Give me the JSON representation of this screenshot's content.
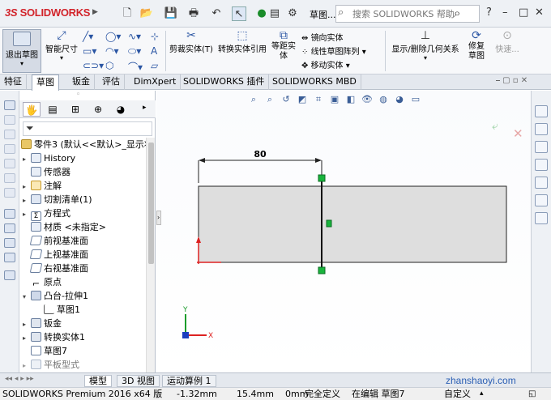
{
  "app": {
    "logo_prefix": "3S",
    "logo_text": "SOLIDWORKS",
    "title": "草图..."
  },
  "quick_access": [
    "new-icon",
    "open-icon",
    "save-icon",
    "print-icon",
    "undo-icon",
    "select-icon",
    "rebuild-icon",
    "file-properties-icon",
    "options-icon"
  ],
  "help_search": {
    "placeholder": "搜索 SOLIDWORKS 帮助"
  },
  "window_controls": {
    "help": "?",
    "minimize": "–",
    "restore": "□",
    "close": "✕"
  },
  "command_manager": {
    "exit_sketch": "退出草图",
    "smart_dimension": "智能尺寸",
    "trim_entities": "剪裁实体(T)",
    "convert_entities": "转换实体引用",
    "offset_entities": "等距实体",
    "mirror_entities": "镜向实体",
    "linear_pattern": "线性草图阵列",
    "move_entities": "移动实体",
    "display_relations": "显示/删除几何关系",
    "repair_sketch": "修复草图",
    "quick_snaps": "快速..."
  },
  "tabs": [
    "特征",
    "草图",
    "钣金",
    "评估",
    "DimXpert",
    "SOLIDWORKS 插件",
    "SOLIDWORKS MBD"
  ],
  "active_tab": "草图",
  "feature_tree": {
    "root": "零件3 (默认<<默认>_显示状",
    "items": [
      {
        "label": "History",
        "exp": "▸"
      },
      {
        "label": "传感器",
        "exp": ""
      },
      {
        "label": "注解",
        "exp": "▸"
      },
      {
        "label": "切割清单(1)",
        "exp": "▸"
      },
      {
        "label": "方程式",
        "exp": "▸"
      },
      {
        "label": "材质 <未指定>",
        "exp": ""
      },
      {
        "label": "前视基准面",
        "exp": ""
      },
      {
        "label": "上视基准面",
        "exp": ""
      },
      {
        "label": "右视基准面",
        "exp": ""
      },
      {
        "label": "原点",
        "exp": ""
      },
      {
        "label": "凸台-拉伸1",
        "exp": "▾"
      },
      {
        "label": "草图1",
        "exp": ""
      },
      {
        "label": "钣金",
        "exp": "▸"
      },
      {
        "label": "转换实体1",
        "exp": "▸"
      },
      {
        "label": "草图7",
        "exp": ""
      },
      {
        "label": "平板型式",
        "exp": "▸"
      }
    ]
  },
  "sketch": {
    "dimension": "80"
  },
  "model_tabs": [
    "模型",
    "3D 视图",
    "运动算例 1"
  ],
  "active_model_tab": "模型",
  "status_bar": {
    "product": "SOLIDWORKS Premium 2016 x64 版",
    "x": "-1.32mm",
    "y": "15.4mm",
    "z": "0mm",
    "state": "完全定义",
    "editing": "在编辑 草图7",
    "units": "自定义"
  },
  "watermark": "zhanshaoyi.com",
  "colors": {
    "accent": "#2b5fb4",
    "brand_red": "#d2232a",
    "sketch_fill": "#dedede",
    "relation_green": "#19b43c"
  }
}
